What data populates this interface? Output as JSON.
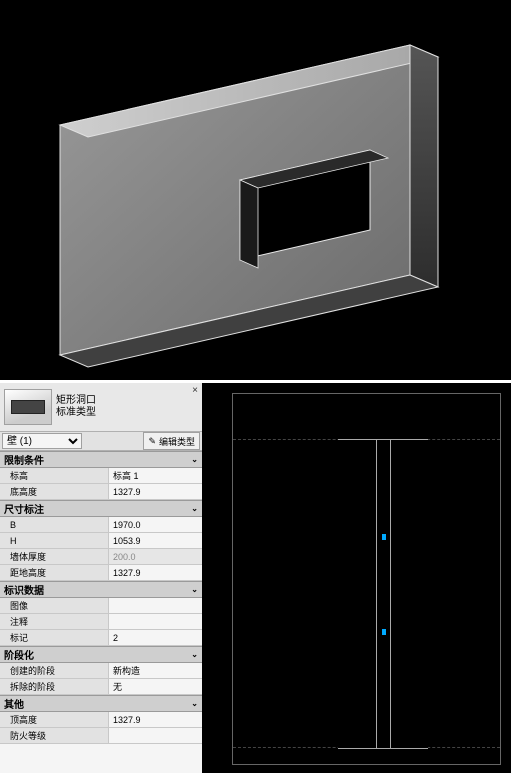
{
  "header": {
    "titleLine1": "矩形洞口",
    "titleLine2": "标准类型",
    "closeGlyph": "×"
  },
  "selector": {
    "label": "壁 (1)",
    "editTypeLabel": "编辑类型"
  },
  "sections": {
    "constraints": "限制条件",
    "dimensions": "尺寸标注",
    "identity": "标识数据",
    "phasing": "阶段化",
    "other": "其他"
  },
  "props": {
    "level_label": "标高",
    "level_value": "标高 1",
    "baseHeight_label": "底高度",
    "baseHeight_value": "1327.9",
    "B_label": "B",
    "B_value": "1970.0",
    "H_label": "H",
    "H_value": "1053.9",
    "wallThickness_label": "墙体厚度",
    "wallThickness_value": "200.0",
    "groundHeight_label": "距地高度",
    "groundHeight_value": "1327.9",
    "image_label": "图像",
    "image_value": "",
    "comment_label": "注释",
    "comment_value": "",
    "mark_label": "标记",
    "mark_value": "2",
    "createdPhase_label": "创建的阶段",
    "createdPhase_value": "新构造",
    "demolishedPhase_label": "拆除的阶段",
    "demolishedPhase_value": "无",
    "topHeight_label": "顶高度",
    "topHeight_value": "1327.9",
    "fireRating_label": "防火等级",
    "fireRating_value": ""
  }
}
